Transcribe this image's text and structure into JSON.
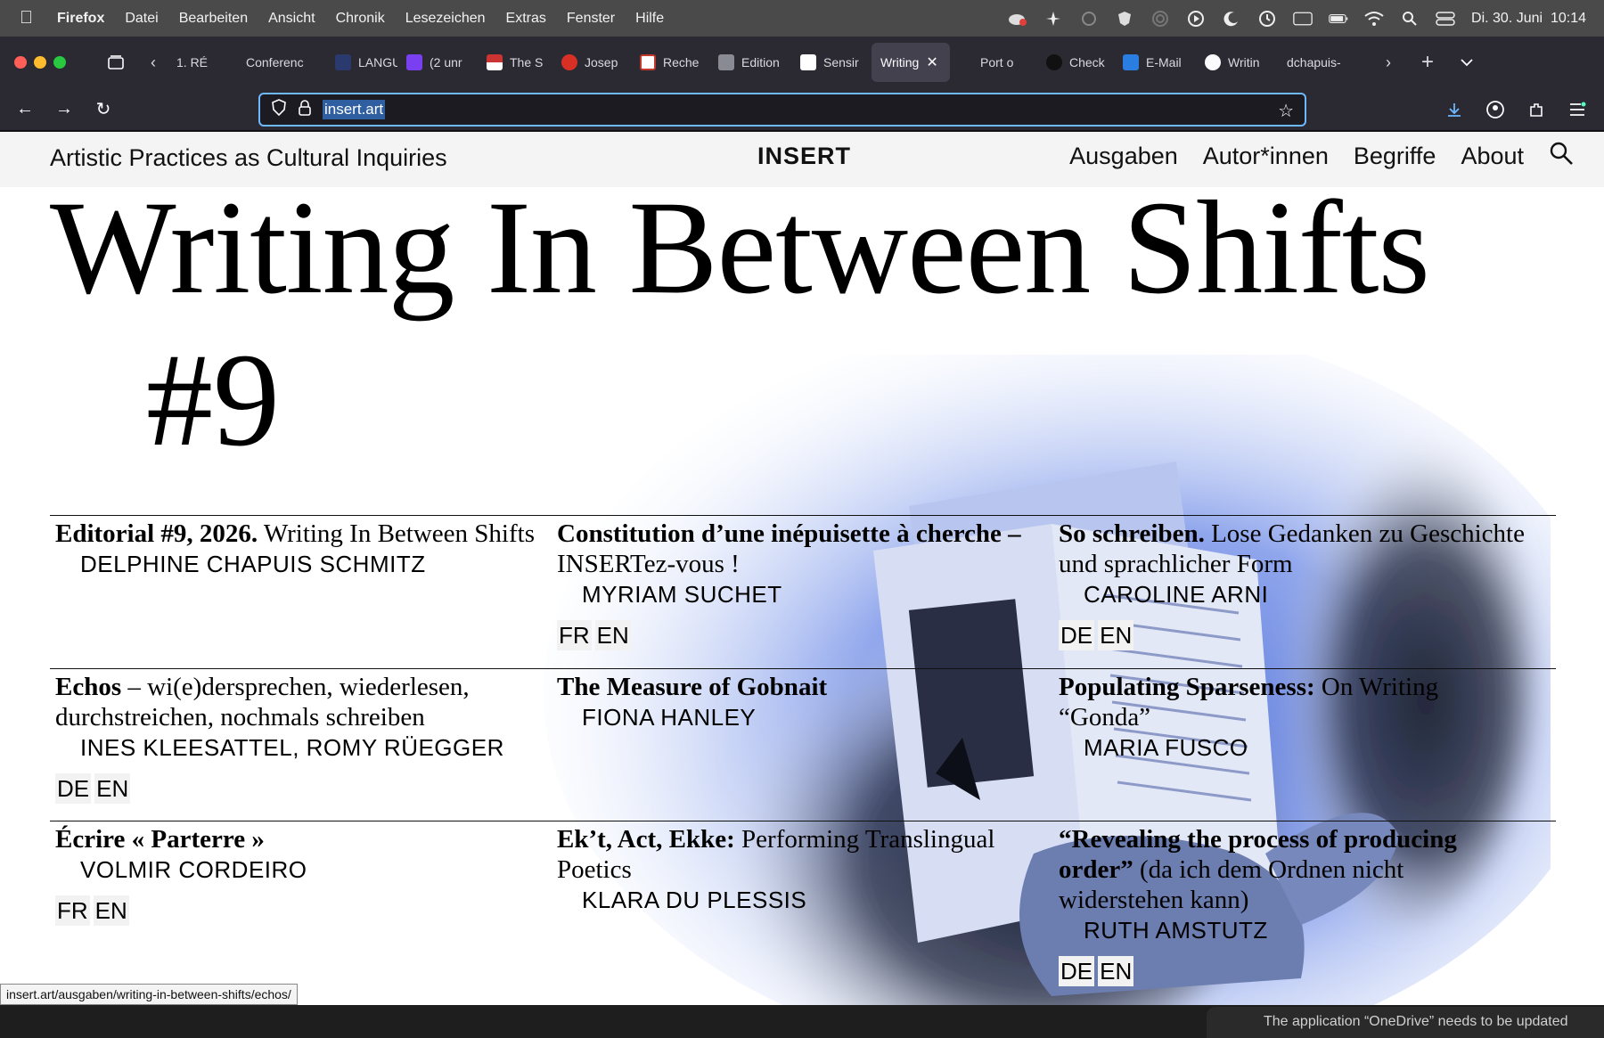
{
  "menubar": {
    "app": "Firefox",
    "items": [
      "Datei",
      "Bearbeiten",
      "Ansicht",
      "Chronik",
      "Lesezeichen",
      "Extras",
      "Fenster",
      "Hilfe"
    ],
    "clock": "Di. 30. Juni  10:14"
  },
  "tabs": [
    {
      "label": "1. RÉ"
    },
    {
      "label": "Conferenc"
    },
    {
      "label": "LANGU"
    },
    {
      "label": "(2 unr"
    },
    {
      "label": "The S"
    },
    {
      "label": "Josep"
    },
    {
      "label": "Reche"
    },
    {
      "label": "Edition"
    },
    {
      "label": "Sensir"
    },
    {
      "label": "Writing",
      "active": true
    },
    {
      "label": "Port o"
    },
    {
      "label": "Check"
    },
    {
      "label": "E-Mail"
    },
    {
      "label": "Writin"
    },
    {
      "label": "dchapuis-"
    }
  ],
  "urlbar": {
    "url": "insert.art"
  },
  "site": {
    "tagline": "Artistic Practices as Cultural Inquiries",
    "logo": "INSERT",
    "nav": [
      "Ausgaben",
      "Autor*innen",
      "Begriffe",
      "About"
    ]
  },
  "issue": {
    "title": "Writing In Between Shifts",
    "number": "#9"
  },
  "articles": [
    {
      "bold": "Editorial #9, 2026.",
      "rest": " Writing In Between Shifts",
      "author": "DELPHINE CHAPUIS SCHMITZ",
      "langs": []
    },
    {
      "bold": "Constitution d’une inépuisette à cherche –",
      "rest": " INSERTez-vous !",
      "author": "MYRIAM SUCHET",
      "langs": [
        "FR",
        "EN"
      ]
    },
    {
      "bold": "So schreiben.",
      "rest": " Lose Gedanken zu Geschichte und sprachlicher Form",
      "author": "CAROLINE ARNI",
      "langs": [
        "DE",
        "EN"
      ]
    },
    {
      "bold": "Echos",
      "rest": " – wi(e)dersprechen, wiederlesen, durchstreichen, nochmals schreiben",
      "author": "INES KLEESATTEL, ROMY RÜEGGER",
      "langs": [
        "DE",
        "EN"
      ]
    },
    {
      "bold": "The Measure of Gobnait",
      "rest": "",
      "author": "FIONA HANLEY",
      "langs": []
    },
    {
      "bold": "Populating Sparseness:",
      "rest": " On Writing “Gonda”",
      "author": "MARIA FUSCO",
      "langs": []
    },
    {
      "bold": "Écrire « Parterre »",
      "rest": "",
      "author": "VOLMIR CORDEIRO",
      "langs": [
        "FR",
        "EN"
      ]
    },
    {
      "bold": "Ek’t, Act, Ekke:",
      "rest": " Performing Translingual Poetics",
      "author": "KLARA DU PLESSIS",
      "langs": []
    },
    {
      "bold": "“Revealing the process of producing order”",
      "rest": " (da ich dem Ordnen nicht widerstehen kann)",
      "author": "RUTH AMSTUTZ",
      "langs": [
        "DE",
        "EN"
      ]
    }
  ],
  "status_link": "insert.art/ausgaben/writing-in-between-shifts/echos/",
  "notification": "The application “OneDrive” needs to be updated"
}
